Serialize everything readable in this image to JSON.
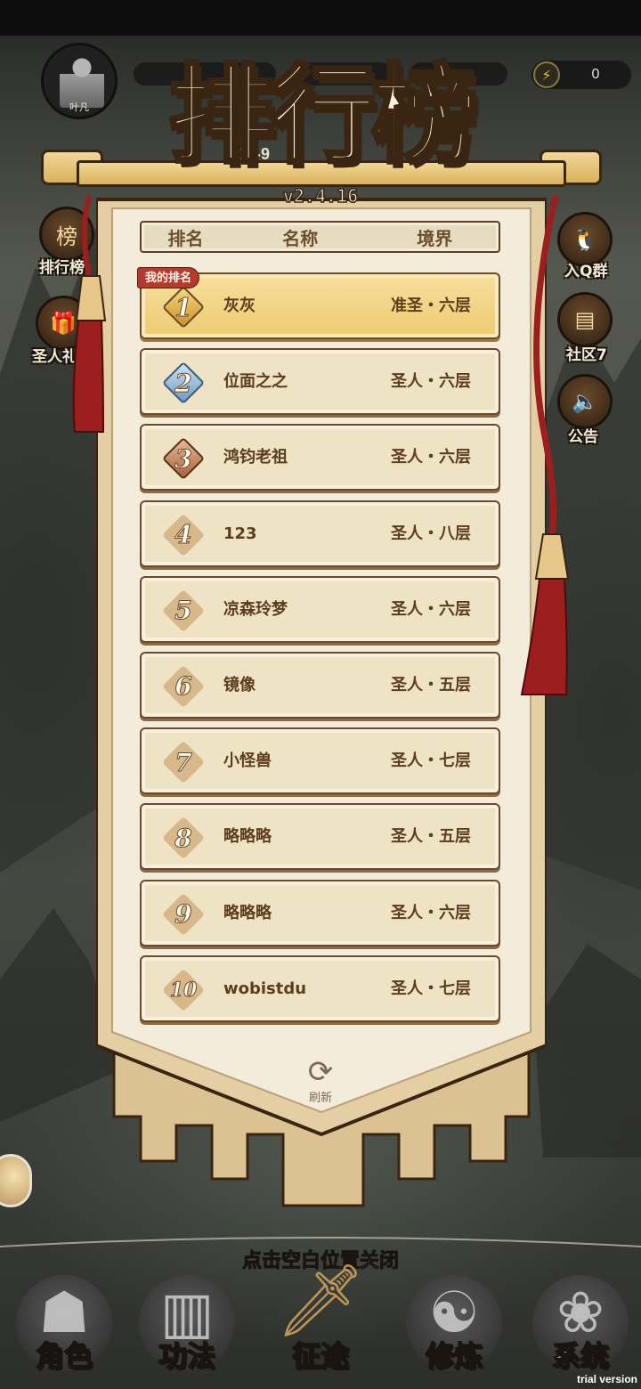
{
  "hud": {
    "player_name": "叶凡",
    "energy_value": "0",
    "energy_icon": "lightning-icon",
    "stage_label": "18-9"
  },
  "side_left": [
    {
      "label": "排行榜",
      "icon": "leaderboard-icon"
    },
    {
      "label": "圣人礼",
      "icon": "gift-icon"
    }
  ],
  "side_right": [
    {
      "label": "入Q群",
      "icon": "penguin-icon"
    },
    {
      "label": "社区7",
      "icon": "chat-icon"
    },
    {
      "label": "公告",
      "icon": "speaker-icon"
    }
  ],
  "leaderboard": {
    "title": "排行榜",
    "version": "v2.4.16",
    "headers": {
      "rank": "排名",
      "name": "名称",
      "realm": "境界"
    },
    "my_rank_tag": "我的排名",
    "rows": [
      {
        "rank": "1",
        "name": "灰灰",
        "realm": "准圣・六层",
        "mine": true
      },
      {
        "rank": "2",
        "name": "位面之之",
        "realm": "圣人・六层"
      },
      {
        "rank": "3",
        "name": "鸿钧老祖",
        "realm": "圣人・六层"
      },
      {
        "rank": "4",
        "name": "123",
        "realm": "圣人・八层"
      },
      {
        "rank": "5",
        "name": "凉森玲梦",
        "realm": "圣人・六层"
      },
      {
        "rank": "6",
        "name": "镜像",
        "realm": "圣人・五层"
      },
      {
        "rank": "7",
        "name": "小怪兽",
        "realm": "圣人・七层"
      },
      {
        "rank": "8",
        "name": "略略略",
        "realm": "圣人・五层"
      },
      {
        "rank": "9",
        "name": "略略略",
        "realm": "圣人・六层"
      },
      {
        "rank": "10",
        "name": "wobistdu",
        "realm": "圣人・七层"
      }
    ],
    "refresh_label": "刷新",
    "refresh_icon": "refresh-icon"
  },
  "close_hint": "点击空白位置关闭",
  "bottom_nav": [
    {
      "label": "角色",
      "icon": "character-icon"
    },
    {
      "label": "功法",
      "icon": "book-icon"
    },
    {
      "label": "征途",
      "icon": "sword-icon",
      "active": true
    },
    {
      "label": "修炼",
      "icon": "meditate-icon"
    },
    {
      "label": "系统",
      "icon": "settings-icon"
    }
  ],
  "watermark": "trial version",
  "colors": {
    "banner_paper": "#f4ecda",
    "row_bg": "#efe3c6",
    "my_row_bg": "#f0d27e",
    "outline": "#3a2412",
    "tag_red": "#b23a2e",
    "tassel_red": "#9c1e1e"
  }
}
